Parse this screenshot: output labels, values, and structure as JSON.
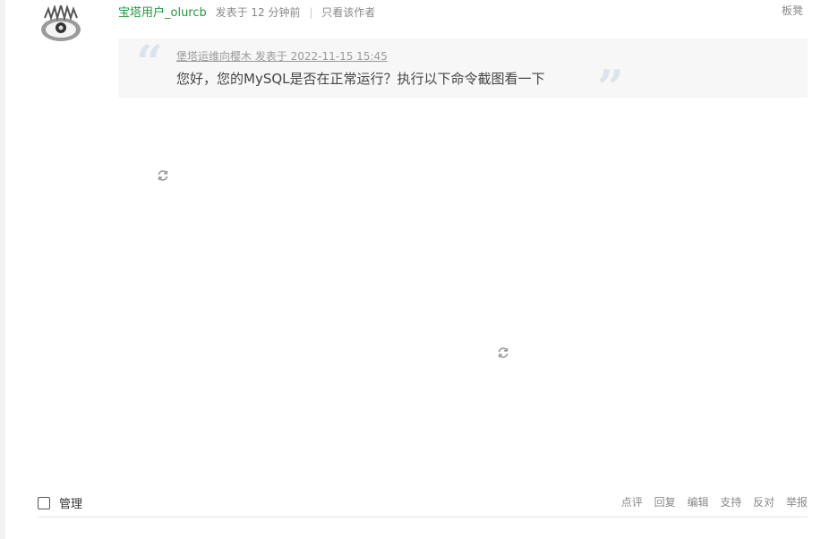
{
  "post": {
    "author": "宝塔用户_olurcb",
    "posted_text": "发表于 12 分钟前",
    "only_author": "只看该作者",
    "floor": "板凳"
  },
  "quote": {
    "header": "堡塔运维向樱木 发表于 2022-11-15 15:45",
    "text": "您好，您的MySQL是否在正常运行？执行以下命令截图看一下"
  },
  "footer": {
    "manage_label": "管理",
    "actions": [
      "点评",
      "回复",
      "编辑",
      "支持",
      "反对",
      "举报"
    ]
  },
  "colors": {
    "author_green": "#1e9a3c",
    "quote_bg": "#f7f7f7",
    "quote_mark": "#dbe4ec"
  },
  "icons": {
    "reload": "reload-icon",
    "avatar": "avatar-image"
  }
}
